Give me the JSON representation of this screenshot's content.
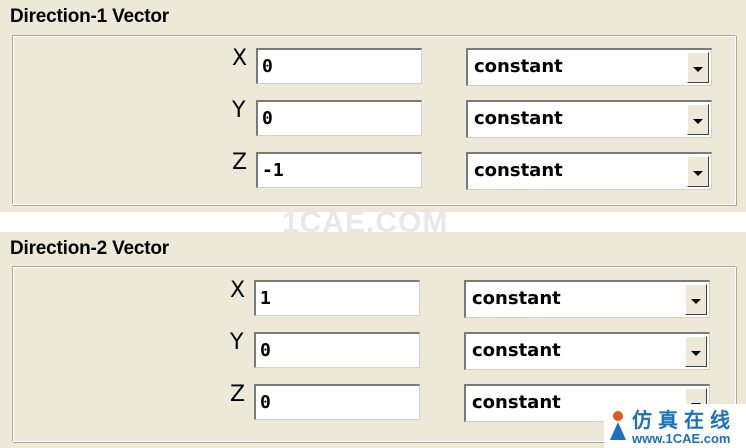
{
  "panel1": {
    "title": "Direction-1 Vector",
    "rows": [
      {
        "axis": "X",
        "value": "0",
        "mode": "constant"
      },
      {
        "axis": "Y",
        "value": "0",
        "mode": "constant"
      },
      {
        "axis": "Z",
        "value": "-1",
        "mode": "constant"
      }
    ]
  },
  "panel2": {
    "title": "Direction-2 Vector",
    "rows": [
      {
        "axis": "X",
        "value": "1",
        "mode": "constant"
      },
      {
        "axis": "Y",
        "value": "0",
        "mode": "constant"
      },
      {
        "axis": "Z",
        "value": "0",
        "mode": "constant"
      }
    ]
  },
  "watermark": "1CAE.COM",
  "brand": {
    "chinese": "仿真在线",
    "url": "www.1CAE.com"
  },
  "colors": {
    "panel_bg": "#ece9d8",
    "brand_blue": "#1a6fc0"
  }
}
